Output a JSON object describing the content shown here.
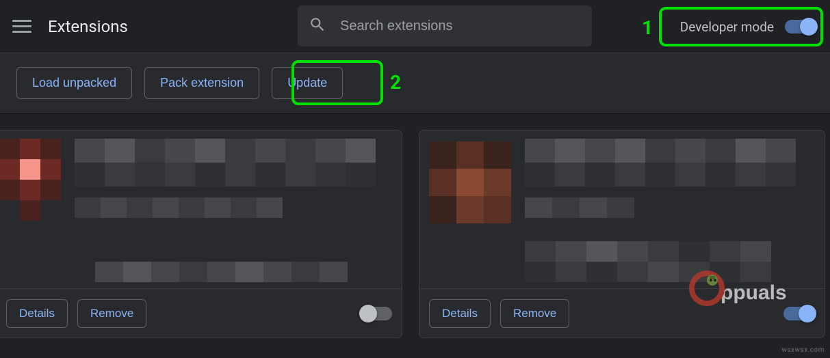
{
  "header": {
    "title": "Extensions",
    "search_placeholder": "Search extensions",
    "dev_mode_label": "Developer mode",
    "dev_mode_on": true
  },
  "dev_toolbar": {
    "load_unpacked": "Load unpacked",
    "pack_extension": "Pack extension",
    "update": "Update"
  },
  "annotations": {
    "num1": "1",
    "num2": "2"
  },
  "cards": [
    {
      "details_label": "Details",
      "remove_label": "Remove",
      "enabled": false
    },
    {
      "details_label": "Details",
      "remove_label": "Remove",
      "enabled": true
    }
  ],
  "watermark": {
    "site": "wsxwsx.com",
    "brand": "Appuals"
  }
}
